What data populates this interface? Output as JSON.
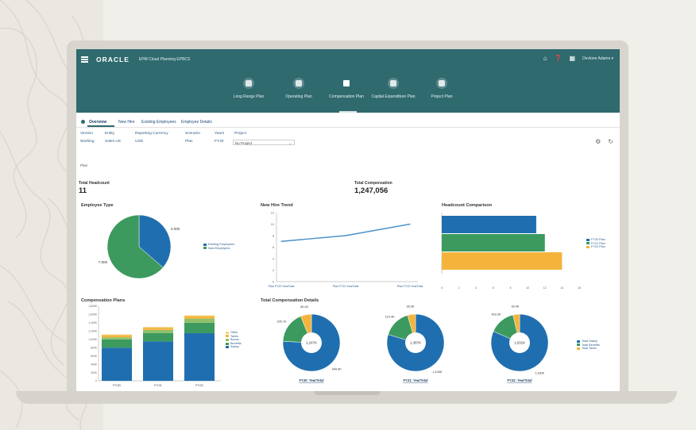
{
  "app": {
    "brand": "ORACLE",
    "title": "EPM Cloud Planning",
    "title_suffix": "EPBCS",
    "user": "Devlone Adams"
  },
  "header_icons": [
    "home-icon",
    "help-icon",
    "grid-icon"
  ],
  "plan_cards": [
    {
      "icon": "target-icon",
      "label": "Long Range Plan"
    },
    {
      "icon": "document-icon",
      "label": "Operating Plan"
    },
    {
      "icon": "people-icon",
      "label": "Compensation Plan",
      "active": true
    },
    {
      "icon": "globe-icon",
      "label": "Capital Expenditure Plan"
    },
    {
      "icon": "briefcase-icon",
      "label": "Project Plan"
    }
  ],
  "tabs": [
    "Overview",
    "New Hire",
    "Existing Employees",
    "Employee Details"
  ],
  "pov": [
    {
      "label": "Version",
      "value": "Working"
    },
    {
      "label": "Entity",
      "value": "Sales US"
    },
    {
      "label": "Reporting Currency",
      "value": "USD"
    },
    {
      "label": "Scenario",
      "value": "Plan"
    },
    {
      "label": "Years",
      "value": "FY20"
    },
    {
      "label": "Project",
      "value": "No Project"
    }
  ],
  "page_label": "Plan",
  "kpis": {
    "headcount_label": "Total Headcount",
    "headcount_value": "11",
    "comp_label": "Total Compensation",
    "comp_value": "1,247,056"
  },
  "colors": {
    "blue": "#1f6fb0",
    "green": "#3c9a5f",
    "orange": "#f4b43c",
    "teal": "#2f6a6f"
  },
  "chart_data": [
    {
      "id": "employee-type",
      "type": "pie",
      "title": "Employee Type",
      "slices": [
        {
          "label": "Existing Employees",
          "value": 4.0,
          "display": "4.000",
          "color": "#1f6fb0"
        },
        {
          "label": "New Employees",
          "value": 7.0,
          "display": "7.000",
          "color": "#3c9a5f"
        }
      ]
    },
    {
      "id": "new-hire-trend",
      "type": "line",
      "title": "New Hire Trend",
      "categories": [
        "Plan FY20 YearTotal",
        "Plan FY21 YearTotal",
        "Plan FY22 YearTotal"
      ],
      "values": [
        7,
        8,
        10
      ],
      "yticks": [
        "0",
        "2",
        "4",
        "6",
        "8",
        "10",
        "12"
      ],
      "ylim": [
        0,
        12
      ]
    },
    {
      "id": "headcount-comparison",
      "type": "bar",
      "orientation": "horizontal",
      "title": "Headcount Comparison",
      "series": [
        {
          "name": "FY20 Plan",
          "value": 11,
          "color": "#1f6fb0"
        },
        {
          "name": "FY21 Plan",
          "value": 12,
          "color": "#3c9a5f"
        },
        {
          "name": "FY22 Plan",
          "value": 14,
          "color": "#f4b43c"
        }
      ],
      "xticks": [
        "0",
        "2",
        "4",
        "6",
        "8",
        "10",
        "12",
        "14",
        "16"
      ],
      "xlim": [
        0,
        16
      ]
    },
    {
      "id": "compensation-plans",
      "type": "bar",
      "stacked": true,
      "title": "Compensation Plans",
      "categories": [
        "FY20",
        "FY21",
        "FY22"
      ],
      "series": [
        {
          "name": "Salary",
          "values": [
            800000,
            950000,
            1150000
          ],
          "color": "#1f6fb0"
        },
        {
          "name": "Benefits",
          "values": [
            200000,
            200000,
            250000
          ],
          "color": "#3c9a5f"
        },
        {
          "name": "Bonus",
          "values": [
            50000,
            80000,
            100000
          ],
          "color": "#8fc06a"
        },
        {
          "name": "Taxes",
          "values": [
            50000,
            50000,
            60000
          ],
          "color": "#f4b43c"
        },
        {
          "name": "Other",
          "values": [
            20000,
            20000,
            20000
          ],
          "color": "#f6d27d"
        }
      ],
      "yticks": [
        "0",
        "200K",
        "400K",
        "600K",
        "800K",
        "1,000K",
        "1,200K",
        "1,400K",
        "1,600K",
        "1,800K"
      ],
      "ylim": [
        0,
        1800000
      ]
    },
    {
      "id": "total-compensation-details",
      "type": "pie",
      "donut": true,
      "title": "Total Compensation Details",
      "legend": [
        "Total Salary",
        "Total Benefits",
        "Total Taxes"
      ],
      "colors": [
        "#1f6fb0",
        "#3c9a5f",
        "#f4b43c"
      ],
      "donuts": [
        {
          "label": "FY20: YearTotal",
          "center": "1,247K",
          "slices": [
            944.9,
            225.7,
            76.4
          ],
          "display": [
            "944.9K",
            "225.7K",
            "80.4K"
          ]
        },
        {
          "label": "FY21: YearTotal",
          "center": "1,387K",
          "slices": [
            1105,
            220,
            62
          ],
          "display": [
            "1,105K",
            "219.4K",
            "65.3K"
          ]
        },
        {
          "label": "FY22: YearTotal",
          "center": "1,631K",
          "slices": [
            1330,
            240,
            61
          ],
          "display": [
            "1,330K",
            "403.3K",
            "60.4K"
          ]
        }
      ]
    }
  ]
}
